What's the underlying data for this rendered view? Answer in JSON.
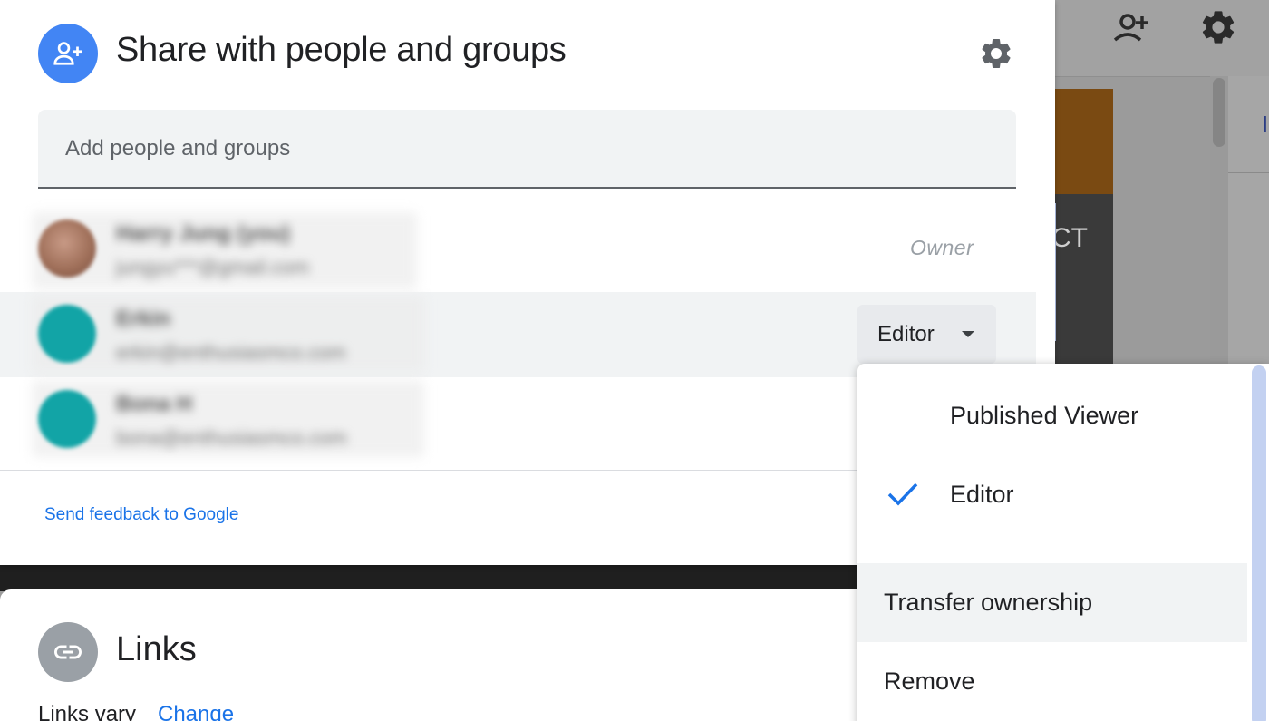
{
  "share_dialog": {
    "title": "Share with people and groups",
    "add_input_placeholder": "Add people and groups",
    "people": [
      {
        "name": "Harry Jung (you)",
        "email": "jungyu***@gmail.com",
        "role": "Owner",
        "avatar_color": "#a0705a"
      },
      {
        "name": "Erkin",
        "email": "erkin@enthusiasmco.com",
        "role": "Editor",
        "avatar_color": "#12a4a6"
      },
      {
        "name": "Bona H",
        "email": "bona@enthusiasmco.com",
        "role": "",
        "avatar_color": "#12a4a6"
      }
    ],
    "feedback_link": "Send feedback to Google",
    "accent_color": "#4285f4"
  },
  "role_menu": {
    "items": [
      {
        "label": "Published Viewer",
        "checked": false
      },
      {
        "label": "Editor",
        "checked": true
      },
      {
        "label": "Transfer ownership",
        "checked": false
      },
      {
        "label": "Remove",
        "checked": false
      }
    ]
  },
  "links_section": {
    "title": "Links",
    "status": "Links vary",
    "change_link": "Change"
  },
  "background": {
    "partial_text": "CT",
    "partial_char": "I"
  }
}
